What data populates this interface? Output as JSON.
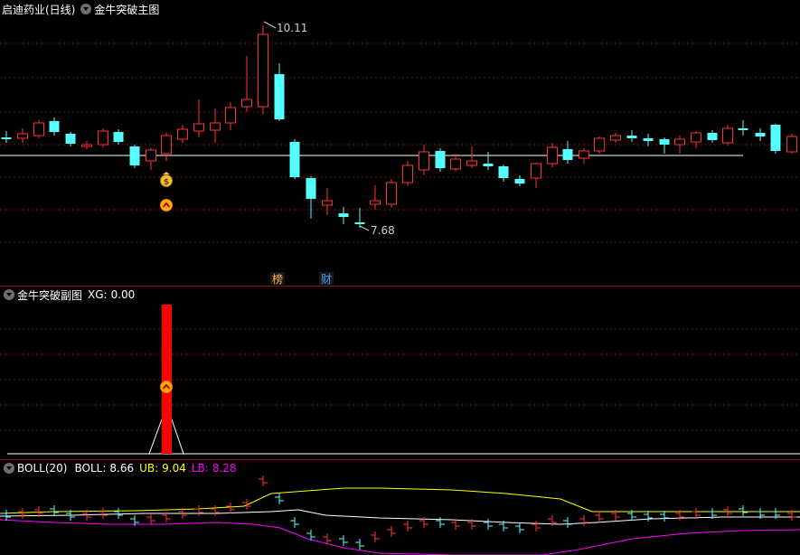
{
  "main": {
    "stock_title": "启迪药业(日线)",
    "indicator_title": "金牛突破主图",
    "high_label": "10.11",
    "low_label": "7.68",
    "markers": {
      "bang": "榜",
      "cai": "财"
    },
    "icons": [
      "money-bag-icon",
      "up-arrow-icon"
    ]
  },
  "sub": {
    "title": "金牛突破副图",
    "xg_label": "XG:",
    "xg_value": "0.00",
    "icons": [
      "up-arrow-icon"
    ]
  },
  "boll": {
    "title": "BOLL(20)",
    "mid_label": "BOLL:",
    "mid_value": "8.66",
    "ub_label": "UB:",
    "ub_value": "9.04",
    "lb_label": "LB:",
    "lb_value": "8.28"
  },
  "colors": {
    "up": "#ff3232",
    "down": "#54ffff",
    "ub": "#ffff00",
    "mid": "#ffffff",
    "lb": "#ff00ff",
    "grid": "#7a1414",
    "signal_bar": "#ff0000",
    "text_yellow": "#ffff00",
    "text_magenta": "#ff00ff"
  }
}
